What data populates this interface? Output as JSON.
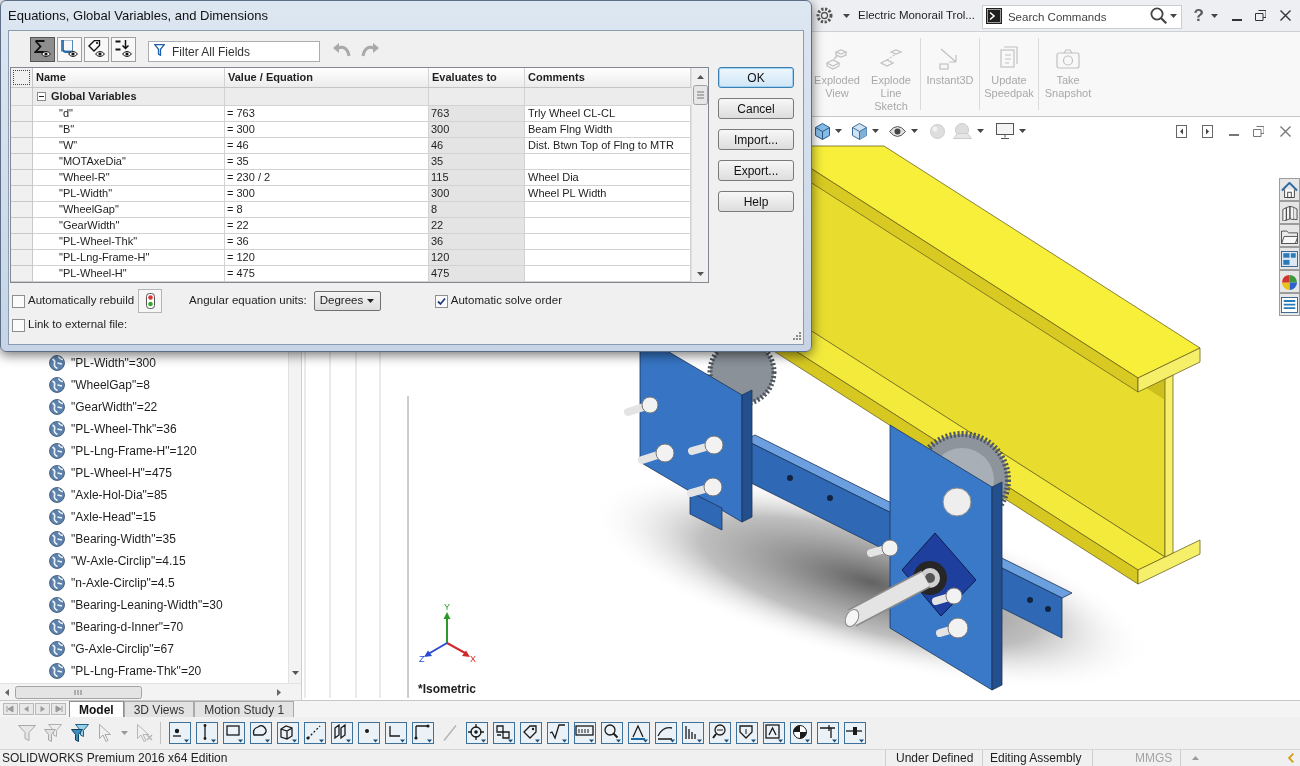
{
  "dialog": {
    "title": "Equations, Global Variables, and Dimensions",
    "view_buttons": [
      {
        "selected": true
      },
      {
        "selected": false
      },
      {
        "selected": false
      },
      {
        "selected": false
      }
    ],
    "filter": {
      "placeholder": "Filter All Fields"
    },
    "undo": {
      "disabled": true
    },
    "redo": {
      "disabled": true
    },
    "table": {
      "columns": [
        "Name",
        "Value / Equation",
        "Evaluates to",
        "Comments"
      ],
      "group": {
        "label": "Global Variables",
        "expanded": true
      },
      "rows": [
        {
          "name": "\"d\"",
          "value": "= 763",
          "evaluates_to": "763",
          "comment": "Trly Wheel CL-CL"
        },
        {
          "name": "\"B\"",
          "value": "= 300",
          "evaluates_to": "300",
          "comment": "Beam Flng Width"
        },
        {
          "name": "\"W\"",
          "value": "= 46",
          "evaluates_to": "46",
          "comment": "Dist. Btwn Top of Flng to MTR"
        },
        {
          "name": "\"MOTAxeDia\"",
          "value": "= 35",
          "evaluates_to": "35"
        },
        {
          "name": "\"Wheel-R\"",
          "value": "= 230 / 2",
          "evaluates_to": "115",
          "comment": "Wheel Dia"
        },
        {
          "name": "\"PL-Width\"",
          "value": "= 300",
          "evaluates_to": "300",
          "comment": "Wheel PL Width"
        },
        {
          "name": "\"WheelGap\"",
          "value": "= 8",
          "evaluates_to": "8"
        },
        {
          "name": "\"GearWidth\"",
          "value": "= 22",
          "evaluates_to": "22"
        },
        {
          "name": "\"PL-Wheel-Thk\"",
          "value": "= 36",
          "evaluates_to": "36"
        },
        {
          "name": "\"PL-Lng-Frame-H\"",
          "value": "= 120",
          "evaluates_to": "120"
        },
        {
          "name": "\"PL-Wheel-H\"",
          "value": "= 475",
          "evaluates_to": "475"
        }
      ]
    },
    "buttons": [
      {
        "label": "OK",
        "default": true
      },
      {
        "label": "Cancel",
        "default": false
      },
      {
        "label": "Import...",
        "default": false
      },
      {
        "label": "Export...",
        "default": false
      },
      {
        "label": "Help",
        "default": false
      }
    ],
    "options": {
      "auto_rebuild": {
        "label": "Automatically rebuild",
        "checked": false
      },
      "angular_units": {
        "label": "Angular equation units:",
        "value": "Degrees"
      },
      "auto_solve_order": {
        "label": "Automatic solve order",
        "checked": true
      },
      "link_external": {
        "label": "Link to external file:",
        "checked": false
      }
    }
  },
  "app_header": {
    "document_title": "Electric Monorail Trol...",
    "search": {
      "placeholder": "Search Commands"
    },
    "help_label": "?"
  },
  "ribbon": {
    "groups": [
      {
        "buttons": [
          {
            "label": "Exploded View",
            "disabled": true
          },
          {
            "label": "Explode Line Sketch",
            "disabled": true
          }
        ]
      },
      {
        "buttons": [
          {
            "label": "Instant3D",
            "disabled": true
          }
        ]
      },
      {
        "buttons": [
          {
            "label": "Update Speedpak",
            "disabled": true
          }
        ]
      },
      {
        "buttons": [
          {
            "label": "Take Snapshot",
            "disabled": true
          }
        ]
      }
    ]
  },
  "feature_tree": {
    "items": [
      {
        "label": "\"PL-Width\"=300"
      },
      {
        "label": "\"WheelGap\"=8"
      },
      {
        "label": "\"GearWidth\"=22"
      },
      {
        "label": "\"PL-Wheel-Thk\"=36"
      },
      {
        "label": "\"PL-Lng-Frame-H\"=120"
      },
      {
        "label": "\"PL-Wheel-H\"=475"
      },
      {
        "label": "\"Axle-Hol-Dia\"=85"
      },
      {
        "label": "\"Axle-Head\"=15"
      },
      {
        "label": "\"Bearing-Width\"=35"
      },
      {
        "label": "\"W-Axle-Circlip\"=4.15"
      },
      {
        "label": "\"n-Axle-Circlip\"=4.5"
      },
      {
        "label": "\"Bearing-Leaning-Width\"=30"
      },
      {
        "label": "\"Bearing-d-Inner\"=70"
      },
      {
        "label": "\"G-Axle-Circlip\"=67"
      },
      {
        "label": "\"PL-Lng-Frame-Thk\"=20"
      }
    ]
  },
  "graphics_area": {
    "view_name": "*Isometric",
    "triad": {
      "x_label": "X",
      "y_label": "Y",
      "z_label": "Z"
    }
  },
  "tabs": [
    {
      "label": "Model",
      "selected": true
    },
    {
      "label": "3D Views",
      "selected": false
    },
    {
      "label": "Motion Study 1",
      "selected": false
    }
  ],
  "status_bar": {
    "product": "SOLIDWORKS Premium 2016 x64 Edition",
    "fields": [
      {
        "text": "Under Defined",
        "disabled": false
      },
      {
        "text": "Editing Assembly",
        "disabled": false
      },
      {
        "text": "MMGS",
        "disabled": true
      }
    ]
  }
}
